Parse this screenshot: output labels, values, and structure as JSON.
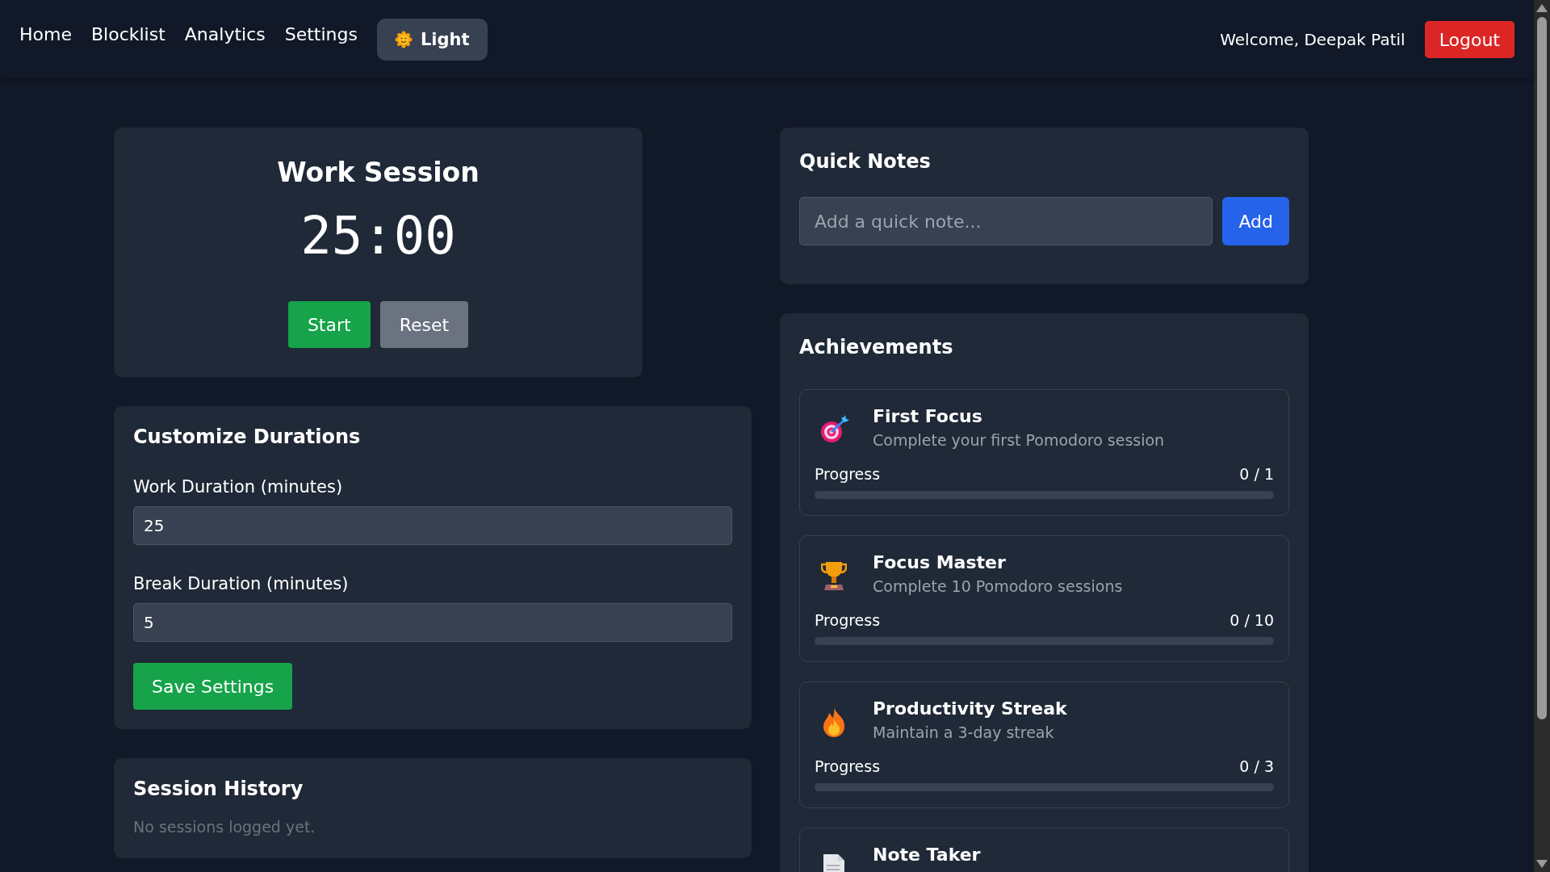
{
  "nav": {
    "links": [
      {
        "label": "Home"
      },
      {
        "label": "Blocklist"
      },
      {
        "label": "Analytics"
      },
      {
        "label": "Settings"
      }
    ],
    "theme_button": "Light",
    "welcome": "Welcome, Deepak Patil",
    "logout": "Logout"
  },
  "timer": {
    "title": "Work Session",
    "time": "25:00",
    "buttons": [
      {
        "label": "Start",
        "kind": "primary"
      },
      {
        "label": "Reset",
        "kind": "secondary"
      }
    ]
  },
  "durations": {
    "title": "Customize Durations",
    "fields": [
      {
        "label": "Work Duration (minutes)",
        "value": "25"
      },
      {
        "label": "Break Duration (minutes)",
        "value": "5"
      }
    ],
    "save": "Save Settings"
  },
  "history": {
    "title": "Session History",
    "empty": "No sessions logged yet."
  },
  "notes": {
    "title": "Quick Notes",
    "placeholder": "Add a quick note...",
    "add": "Add"
  },
  "achievements": {
    "title": "Achievements",
    "items": [
      {
        "kind": "target",
        "name": "First Focus",
        "description": "Complete your first Pomodoro session",
        "progress_label": "Progress",
        "count": "0 / 1",
        "level": 0
      },
      {
        "kind": "trophy",
        "name": "Focus Master",
        "description": "Complete 10 Pomodoro sessions",
        "progress_label": "Progress",
        "count": "0 / 10",
        "level": 0
      },
      {
        "kind": "flame",
        "name": "Productivity Streak",
        "description": "Maintain a 3-day streak",
        "progress_label": "Progress",
        "count": "0 / 3",
        "level": 0
      },
      {
        "kind": "note",
        "name": "Note Taker"
      }
    ]
  }
}
